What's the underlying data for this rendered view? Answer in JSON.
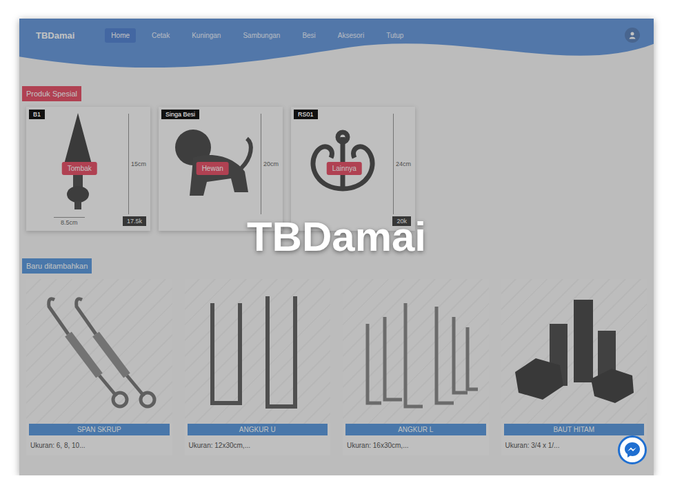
{
  "window": {
    "title": "TBDamai"
  },
  "navbar": {
    "brand": "TBDamai",
    "items": [
      {
        "label": "Home",
        "selected": true
      },
      {
        "label": "Cetak",
        "selected": false
      },
      {
        "label": "Kuningan",
        "selected": false
      },
      {
        "label": "Sambungan",
        "selected": false
      },
      {
        "label": "Besi",
        "selected": false
      },
      {
        "label": "Aksesori",
        "selected": false
      },
      {
        "label": "Tutup",
        "selected": false
      }
    ]
  },
  "special": {
    "title": "Produk Spesial",
    "items": [
      {
        "kind": "spear",
        "tag": "B1",
        "badge": "Tombak",
        "height": "15cm",
        "width": "8.5cm",
        "price": "17.5k"
      },
      {
        "kind": "lion",
        "tag": "Singa Besi",
        "badge": "Hewan",
        "height": "20cm"
      },
      {
        "kind": "scroll",
        "tag": "RS01",
        "badge": "Lainnya",
        "height": "24cm",
        "price": "20k"
      }
    ]
  },
  "latest": {
    "title": "Baru ditambahkan",
    "items": [
      {
        "kind": "turnbuckle",
        "name": "SPAN SKRUP",
        "caption": "Ukuran: 6, 8, 10..."
      },
      {
        "kind": "ubolt",
        "name": "ANGKUR U",
        "caption": "Ukuran: 12x30cm,..."
      },
      {
        "kind": "lbolt",
        "name": "ANGKUR L",
        "caption": "Ukuran: 16x30cm,..."
      },
      {
        "kind": "bolt",
        "name": "BAUT HITAM",
        "caption": "Ukuran: 3/4 x 1/..."
      }
    ]
  }
}
